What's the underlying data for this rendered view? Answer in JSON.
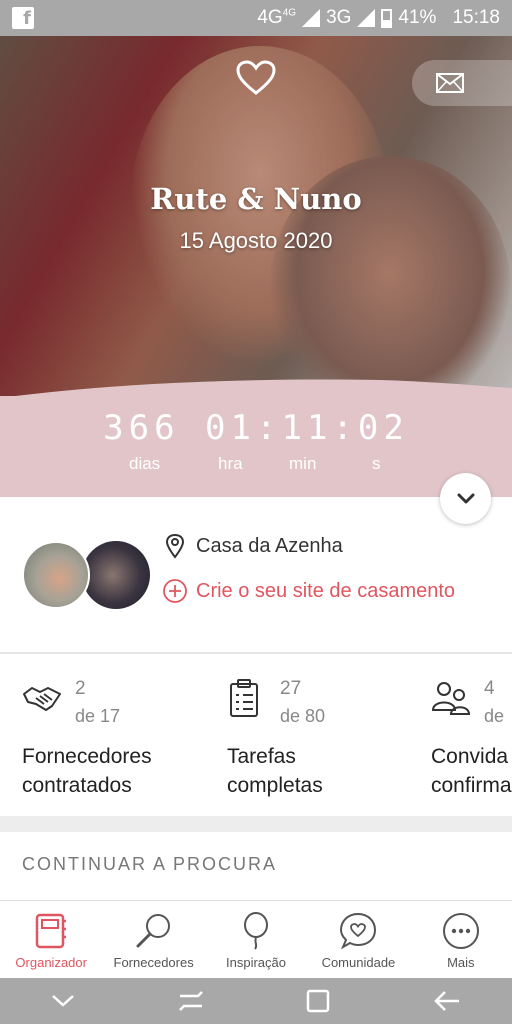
{
  "status_bar": {
    "network1": "4G",
    "network1_sup": "4G",
    "network2": "3G",
    "battery": "41%",
    "time": "15:18"
  },
  "hero": {
    "names": "Rute & Nuno",
    "date": "15 Agosto 2020"
  },
  "countdown": {
    "days": "366",
    "hours": "01",
    "minutes": "11",
    "seconds": "02",
    "days_label": "dias",
    "hours_label": "hra",
    "minutes_label": "min",
    "seconds_label": "s"
  },
  "profile": {
    "location": "Casa da Azenha",
    "website_cta": "Crie o seu site de casamento"
  },
  "stats": [
    {
      "count": "2",
      "total": "de 17",
      "label_line1": "Fornecedores",
      "label_line2": "contratados",
      "icon": "handshake-icon"
    },
    {
      "count": "27",
      "total": "de 80",
      "label_line1": "Tarefas",
      "label_line2": "completas",
      "icon": "clipboard-icon"
    },
    {
      "count": "4",
      "total": "de",
      "label_line1": "Convida",
      "label_line2": "confirma",
      "icon": "guests-icon"
    }
  ],
  "continue_section": {
    "title": "CONTINUAR A PROCURA"
  },
  "bottom_nav": [
    {
      "label": "Organizador",
      "icon": "planner-icon",
      "active": true
    },
    {
      "label": "Fornecedores",
      "icon": "search-icon",
      "active": false
    },
    {
      "label": "Inspiração",
      "icon": "balloon-icon",
      "active": false
    },
    {
      "label": "Comunidade",
      "icon": "chat-heart-icon",
      "active": false
    },
    {
      "label": "Mais",
      "icon": "more-icon",
      "active": false
    }
  ],
  "colors": {
    "accent": "#e05660",
    "countdown_bg": "#e2c5c9",
    "status_bar_bg": "#a8a8a8"
  }
}
